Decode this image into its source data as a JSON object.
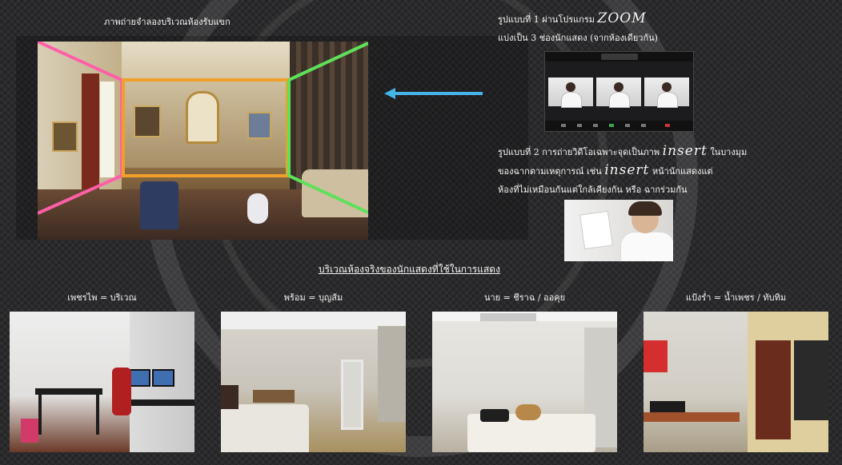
{
  "living_room_caption": "ภาพถ่ายจำลองบริเวณห้องรับแขก",
  "zoom_note": {
    "line1_prefix": "รูปแบบที่ 1 ผ่านโปรแกรม",
    "line1_term": "ZOOM",
    "line2": "แบ่งเป็น 3 ช่องนักแสดง (จากห้องเดียวกัน)"
  },
  "insert_note": {
    "line1_prefix": "รูปแบบที่ 2 การถ่ายวิดีโอเฉพาะจุดเป็นภาพ",
    "line1_term": "insert",
    "line1_suffix": "ในบางมุม",
    "line2_prefix": "ของฉากตามเหตุการณ์ เช่น",
    "line2_term": "insert",
    "line2_suffix": "หน้านักแสดงแต่",
    "line3": "ห้องที่ไม่เหมือนกันแต่ใกล้เคียงกัน หรือ ฉากร่วมกัน"
  },
  "section_title": "บริเวณห้องจริงของนักแสดงที่ใช้ในการแสดง",
  "rooms": [
    {
      "label": "เพชรไพ = บริเวณ"
    },
    {
      "label": "พร้อม = บุญส้ม"
    },
    {
      "label": "นาย = ชีราฉ / ออคุย"
    },
    {
      "label": "แป้งร่ำ = น้ำเพชร / ทับทิม"
    }
  ],
  "colors": {
    "outline_pink": "#ff5fa8",
    "outline_orange": "#f0a028",
    "outline_green": "#5fe05a",
    "arrow_blue": "#46b4e8",
    "background": "#2a2a2c"
  }
}
